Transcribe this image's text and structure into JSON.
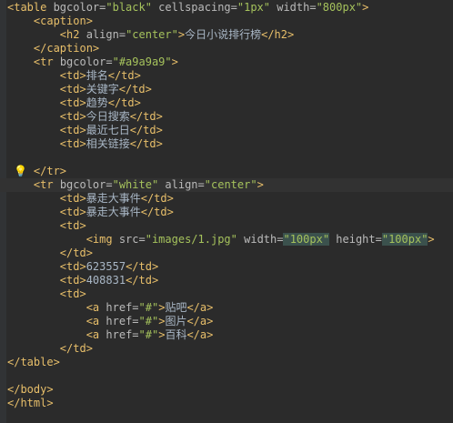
{
  "lines": [
    {
      "segs": [
        {
          "c": "t",
          "t": "<table "
        },
        {
          "c": "a",
          "t": "bgcolor="
        },
        {
          "c": "v",
          "t": "\"black\""
        },
        {
          "c": "a",
          "t": " cellspacing="
        },
        {
          "c": "v",
          "t": "\"1px\""
        },
        {
          "c": "a",
          "t": " width="
        },
        {
          "c": "v",
          "t": "\"800px\""
        },
        {
          "c": "t",
          "t": ">"
        }
      ]
    },
    {
      "segs": [
        {
          "c": "x",
          "t": "    "
        },
        {
          "c": "t",
          "t": "<caption>"
        }
      ]
    },
    {
      "segs": [
        {
          "c": "x",
          "t": "        "
        },
        {
          "c": "t",
          "t": "<h2 "
        },
        {
          "c": "a",
          "t": "align="
        },
        {
          "c": "v",
          "t": "\"center\""
        },
        {
          "c": "t",
          "t": ">"
        },
        {
          "c": "x",
          "t": "今日小说排行榜"
        },
        {
          "c": "t",
          "t": "</h2>"
        }
      ]
    },
    {
      "segs": [
        {
          "c": "x",
          "t": "    "
        },
        {
          "c": "t",
          "t": "</caption>"
        }
      ]
    },
    {
      "segs": [
        {
          "c": "x",
          "t": "    "
        },
        {
          "c": "t",
          "t": "<tr "
        },
        {
          "c": "a",
          "t": "bgcolor="
        },
        {
          "c": "v",
          "t": "\"#a9a9a9\""
        },
        {
          "c": "t",
          "t": ">"
        }
      ]
    },
    {
      "segs": [
        {
          "c": "x",
          "t": "        "
        },
        {
          "c": "t",
          "t": "<td>"
        },
        {
          "c": "x",
          "t": "排名"
        },
        {
          "c": "t",
          "t": "</td>"
        }
      ]
    },
    {
      "segs": [
        {
          "c": "x",
          "t": "        "
        },
        {
          "c": "t",
          "t": "<td>"
        },
        {
          "c": "x",
          "t": "关键字"
        },
        {
          "c": "t",
          "t": "</td>"
        }
      ]
    },
    {
      "segs": [
        {
          "c": "x",
          "t": "        "
        },
        {
          "c": "t",
          "t": "<td>"
        },
        {
          "c": "x",
          "t": "趋势"
        },
        {
          "c": "t",
          "t": "</td>"
        }
      ]
    },
    {
      "segs": [
        {
          "c": "x",
          "t": "        "
        },
        {
          "c": "t",
          "t": "<td>"
        },
        {
          "c": "x",
          "t": "今日搜索"
        },
        {
          "c": "t",
          "t": "</td>"
        }
      ]
    },
    {
      "segs": [
        {
          "c": "x",
          "t": "        "
        },
        {
          "c": "t",
          "t": "<td>"
        },
        {
          "c": "x",
          "t": "最近七日"
        },
        {
          "c": "t",
          "t": "</td>"
        }
      ]
    },
    {
      "segs": [
        {
          "c": "x",
          "t": "        "
        },
        {
          "c": "t",
          "t": "<td>"
        },
        {
          "c": "x",
          "t": "相关链接"
        },
        {
          "c": "t",
          "t": "</td>"
        }
      ]
    },
    {
      "segs": []
    },
    {
      "segs": [
        {
          "c": "x",
          "t": "    "
        },
        {
          "c": "t",
          "t": "</tr>"
        }
      ],
      "bulb": true
    },
    {
      "segs": [
        {
          "c": "x",
          "t": "    "
        },
        {
          "c": "t",
          "t": "<tr "
        },
        {
          "c": "a",
          "t": "bgcolor="
        },
        {
          "c": "v",
          "t": "\"white\""
        },
        {
          "c": "a",
          "t": " align="
        },
        {
          "c": "v",
          "t": "\"center\""
        },
        {
          "c": "t",
          "t": ">"
        }
      ],
      "hl": true
    },
    {
      "segs": [
        {
          "c": "x",
          "t": "        "
        },
        {
          "c": "t",
          "t": "<td>"
        },
        {
          "c": "x",
          "t": "暴走大事件"
        },
        {
          "c": "t",
          "t": "</td>"
        }
      ]
    },
    {
      "segs": [
        {
          "c": "x",
          "t": "        "
        },
        {
          "c": "t",
          "t": "<td>"
        },
        {
          "c": "x",
          "t": "暴走大事件"
        },
        {
          "c": "t",
          "t": "</td>"
        }
      ]
    },
    {
      "segs": [
        {
          "c": "x",
          "t": "        "
        },
        {
          "c": "t",
          "t": "<td>"
        }
      ]
    },
    {
      "segs": [
        {
          "c": "x",
          "t": "            "
        },
        {
          "c": "t",
          "t": "<img "
        },
        {
          "c": "a",
          "t": "src="
        },
        {
          "c": "v",
          "t": "\"images/1.jpg\""
        },
        {
          "c": "a",
          "t": " width="
        },
        {
          "c": "v sel",
          "t": "\"100px\""
        },
        {
          "c": "a",
          "t": " height="
        },
        {
          "c": "v sel",
          "t": "\"100px\""
        },
        {
          "c": "t",
          "t": ">"
        }
      ]
    },
    {
      "segs": [
        {
          "c": "x",
          "t": "        "
        },
        {
          "c": "t",
          "t": "</td>"
        }
      ]
    },
    {
      "segs": [
        {
          "c": "x",
          "t": "        "
        },
        {
          "c": "t",
          "t": "<td>"
        },
        {
          "c": "x",
          "t": "623557"
        },
        {
          "c": "t",
          "t": "</td>"
        }
      ]
    },
    {
      "segs": [
        {
          "c": "x",
          "t": "        "
        },
        {
          "c": "t",
          "t": "<td>"
        },
        {
          "c": "x",
          "t": "408831"
        },
        {
          "c": "t",
          "t": "</td>"
        }
      ]
    },
    {
      "segs": [
        {
          "c": "x",
          "t": "        "
        },
        {
          "c": "t",
          "t": "<td>"
        }
      ]
    },
    {
      "segs": [
        {
          "c": "x",
          "t": "            "
        },
        {
          "c": "t",
          "t": "<a "
        },
        {
          "c": "a",
          "t": "href="
        },
        {
          "c": "v",
          "t": "\"#\""
        },
        {
          "c": "t",
          "t": ">"
        },
        {
          "c": "x",
          "t": "贴吧"
        },
        {
          "c": "t",
          "t": "</a>"
        }
      ]
    },
    {
      "segs": [
        {
          "c": "x",
          "t": "            "
        },
        {
          "c": "t",
          "t": "<a "
        },
        {
          "c": "a",
          "t": "href="
        },
        {
          "c": "v",
          "t": "\"#\""
        },
        {
          "c": "t",
          "t": ">"
        },
        {
          "c": "x",
          "t": "图片"
        },
        {
          "c": "t",
          "t": "</a>"
        }
      ]
    },
    {
      "segs": [
        {
          "c": "x",
          "t": "            "
        },
        {
          "c": "t",
          "t": "<a "
        },
        {
          "c": "a",
          "t": "href="
        },
        {
          "c": "v",
          "t": "\"#\""
        },
        {
          "c": "t",
          "t": ">"
        },
        {
          "c": "x",
          "t": "百科"
        },
        {
          "c": "t",
          "t": "</a>"
        }
      ]
    },
    {
      "segs": [
        {
          "c": "x",
          "t": "        "
        },
        {
          "c": "t",
          "t": "</td>"
        }
      ]
    },
    {
      "segs": [
        {
          "c": "t",
          "t": "</table>"
        }
      ]
    },
    {
      "segs": []
    },
    {
      "segs": [
        {
          "c": "t",
          "t": "</body>"
        }
      ]
    },
    {
      "segs": [
        {
          "c": "t",
          "t": "</html>"
        }
      ]
    }
  ],
  "icons": {
    "intention": "lightbulb-icon"
  },
  "colors": {
    "background": "#2b2b2b",
    "tag": "#e8bf6a",
    "attribute": "#bababa",
    "value": "#a5c25c",
    "text": "#a9b7c6",
    "current_line": "#323232"
  }
}
